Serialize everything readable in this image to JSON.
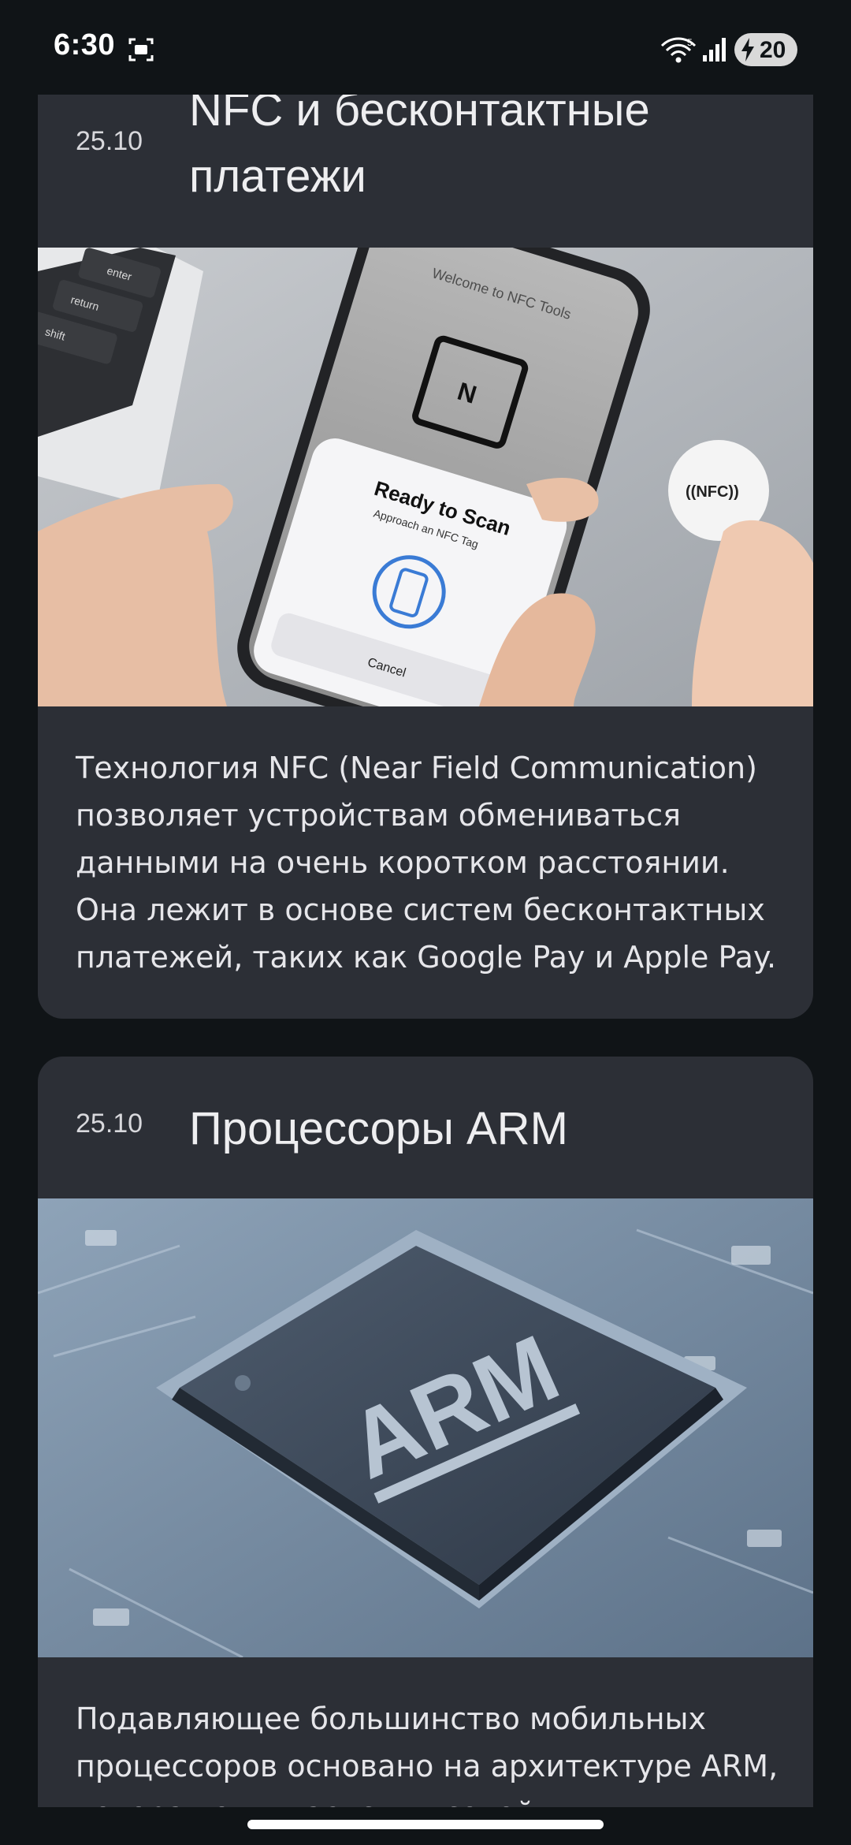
{
  "status_bar": {
    "time": "6:30",
    "battery": "20",
    "icons": [
      "screenshot-icon",
      "wifi-icon",
      "signal-icon",
      "battery-charging-icon"
    ]
  },
  "feed": {
    "cards": [
      {
        "date": "25.10",
        "title": "NFC и бесконтактные платежи",
        "image": {
          "phone_screen_header": "Welcome to NFC Tools",
          "sheet_title": "Ready to Scan",
          "sheet_subtitle": "Approach an NFC Tag",
          "sheet_cancel": "Cancel",
          "tag_label": "((NFC))",
          "keys": [
            "enter",
            "return",
            "shift"
          ]
        },
        "text": "Технология NFC (Near Field Communication) позволяет устройствам обмениваться данными на очень коротком расстоянии. Она лежит в основе систем бесконтактных платежей, таких как Google Pay и Apple Pay."
      },
      {
        "date": "25.10",
        "title": "Процессоры ARM",
        "image": {
          "chip_label": "ARM"
        },
        "text": "Подавляющее большинство мобильных процессоров основано на архитектуре ARM, которая отличается высокой"
      }
    ]
  }
}
